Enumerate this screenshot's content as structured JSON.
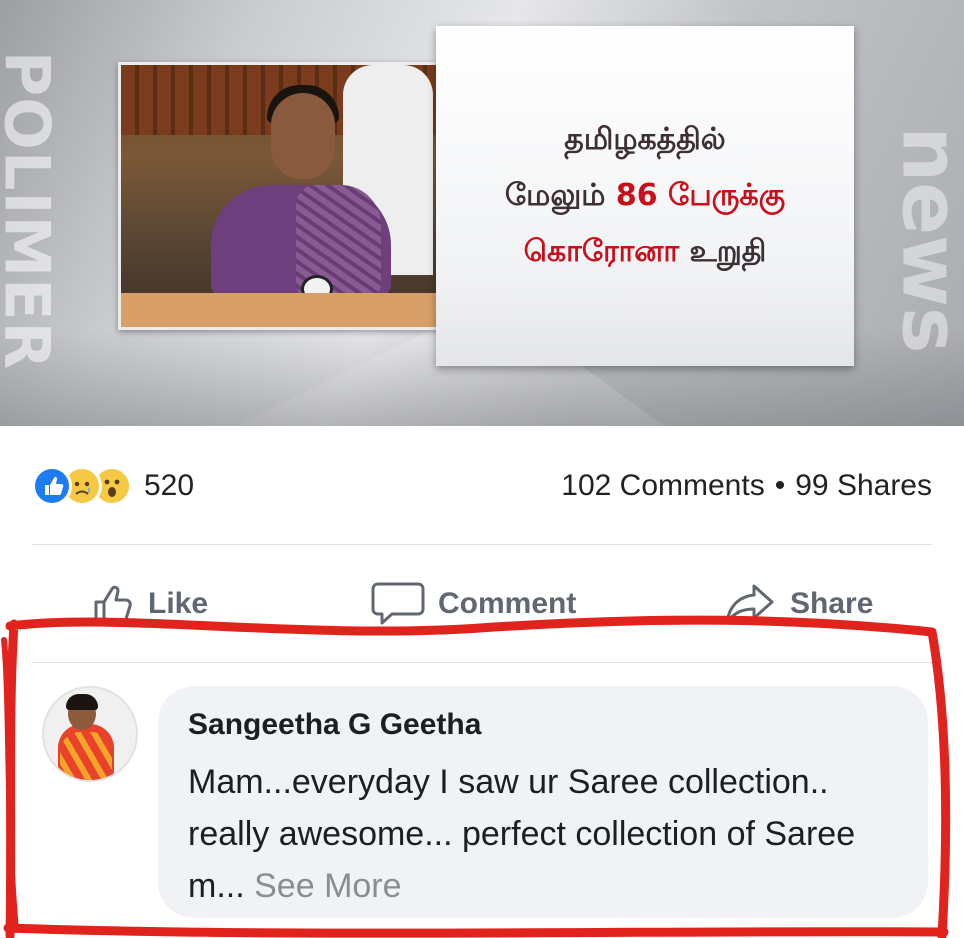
{
  "news_image": {
    "side_brand": "POLIMER",
    "side_news": "news",
    "headline_lines": [
      {
        "text": "தமிழகத்தில்",
        "color": "#3d2f35"
      },
      {
        "text_dark": "மேலும்",
        "text_red": "86 பேருக்கு"
      },
      {
        "text_red": "கொரோனா",
        "text_dark": "உறுதி"
      }
    ]
  },
  "reactions": {
    "icons": [
      "like-icon",
      "sad-icon",
      "wow-icon"
    ],
    "count": "520"
  },
  "stats": {
    "comments": "102 Comments",
    "separator": "•",
    "shares": "99 Shares"
  },
  "actions": {
    "like": "Like",
    "comment": "Comment",
    "share": "Share"
  },
  "comment": {
    "author": "Sangeetha G Geetha",
    "text": "Mam...everyday I saw ur Saree collection.. really awesome... perfect collection of Saree m...",
    "see_more": "See More"
  },
  "colors": {
    "highlight": "#e0231d",
    "like_blue": "#1e7cf2",
    "muted": "#606770"
  }
}
